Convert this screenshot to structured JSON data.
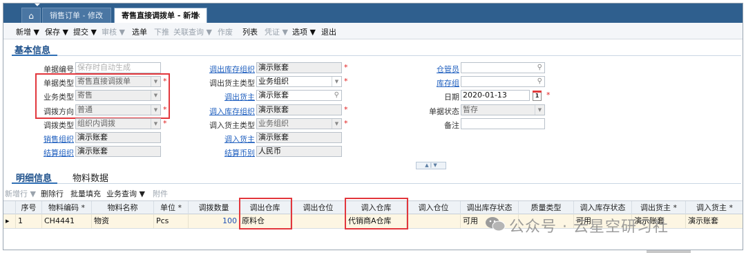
{
  "tabs": {
    "home_icon": "home-icon",
    "tab1": "销售订单 - 修改",
    "tab2": "寄售直接调拨单 - 新增",
    "close": "×"
  },
  "toolbar": [
    {
      "label": "新增 ▼",
      "disabled": false
    },
    {
      "label": "保存 ▼",
      "disabled": false
    },
    {
      "label": "提交 ▼",
      "disabled": false
    },
    {
      "label": "审核 ▼",
      "disabled": true
    },
    {
      "label": "选单",
      "disabled": false
    },
    {
      "label": "下推",
      "disabled": true
    },
    {
      "label": "关联查询 ▼",
      "disabled": true
    },
    {
      "label": "作废",
      "disabled": true
    },
    {
      "label": "列表",
      "disabled": false
    },
    {
      "label": "凭证 ▼",
      "disabled": true
    },
    {
      "label": "选项 ▼",
      "disabled": false
    },
    {
      "label": "退出",
      "disabled": false
    }
  ],
  "basic_section": "基本信息",
  "form": {
    "doc_no": {
      "label": "单据编号",
      "placeholder": "保存时自动生成"
    },
    "doc_type": {
      "label": "单据类型",
      "value": "寄售直接调拨单"
    },
    "biz_type": {
      "label": "业务类型",
      "value": "寄售"
    },
    "direction": {
      "label": "调拨方向",
      "value": "普通"
    },
    "transfer_type": {
      "label": "调拨类型",
      "value": "组织内调拨"
    },
    "sale_org": {
      "label": "销售组织",
      "value": "演示账套"
    },
    "settle_org": {
      "label": "结算组织",
      "value": "演示账套"
    },
    "out_stock_org": {
      "label": "调出库存组织",
      "value": "演示账套"
    },
    "out_owner_type": {
      "label": "调出货主类型",
      "value": "业务组织"
    },
    "out_owner": {
      "label": "调出货主",
      "value": "演示账套"
    },
    "in_stock_org": {
      "label": "调入库存组织",
      "value": "演示账套"
    },
    "in_owner_type": {
      "label": "调入货主类型",
      "value": "业务组织"
    },
    "in_owner": {
      "label": "调入货主",
      "value": "演示账套"
    },
    "currency": {
      "label": "结算币别",
      "value": "人民币"
    },
    "keeper": {
      "label": "仓管员",
      "value": ""
    },
    "stock_group": {
      "label": "库存组",
      "value": ""
    },
    "date": {
      "label": "日期",
      "value": "2020-01-13"
    },
    "status": {
      "label": "单据状态",
      "value": "暂存"
    },
    "remark": {
      "label": "备注",
      "value": ""
    },
    "calendar_day": "1"
  },
  "collapse_glyph": "▲ | ▼",
  "detail_tabs": {
    "detail": "明细信息",
    "material": "物料数据"
  },
  "subbar": [
    {
      "label": "新增行 ▼",
      "disabled": true
    },
    {
      "label": "删除行",
      "disabled": false
    },
    {
      "label": "批量填充",
      "disabled": false
    },
    {
      "label": "业务查询 ▼",
      "disabled": false
    },
    {
      "label": "附件",
      "disabled": true
    }
  ],
  "grid": {
    "columns": [
      "",
      "序号",
      "物料编码 *",
      "物料名称",
      "单位 *",
      "调拨数量",
      "调出仓库",
      "调出仓位",
      "调入仓库",
      "调入仓位",
      "调出库存状态",
      "质量类型",
      "调入库存状态",
      "调出货主 *",
      "调入货主 *"
    ],
    "rows": [
      {
        "marker": "▸",
        "seq": "1",
        "code": "CH4441",
        "name": "物资",
        "unit": "Pcs",
        "qty": "100",
        "out_wh": "原料仓",
        "out_loc": "",
        "in_wh": "代销商A仓库",
        "in_loc": "",
        "out_status": "可用",
        "quality": "",
        "in_status": "可用",
        "out_owner": "演示账套",
        "in_owner": "演示账套"
      }
    ]
  },
  "watermark": "公众号 · 云星空研习社",
  "colors": {
    "brand_blue": "#2f5f8e",
    "link": "#1f5fbf",
    "highlight": "#e2363c",
    "row_bg": "#fdf6e3"
  }
}
